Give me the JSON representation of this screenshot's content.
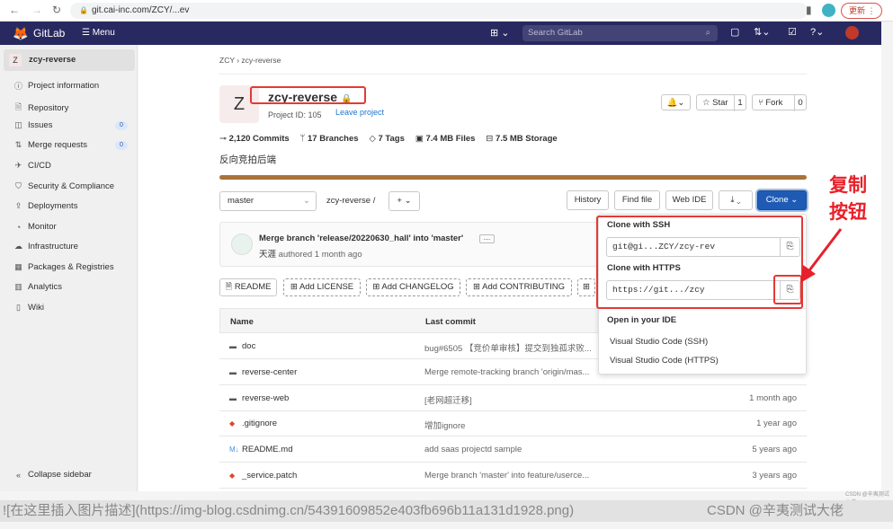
{
  "browser": {
    "url": "git.cai-inc.com/ZCY/...ev",
    "update_label": "更新"
  },
  "nav": {
    "brand": "GitLab",
    "menu": "Menu",
    "search_placeholder": "Search GitLab"
  },
  "sidebar": {
    "project_initial": "Z",
    "project_name": "zcy-reverse",
    "items": [
      {
        "label": "Project information",
        "icon": "info-icon"
      },
      {
        "label": "Repository",
        "icon": "doc-icon"
      },
      {
        "label": "Issues",
        "icon": "issues-icon",
        "badge": "0"
      },
      {
        "label": "Merge requests",
        "icon": "merge-icon",
        "badge": "0"
      },
      {
        "label": "CI/CD",
        "icon": "rocket-icon"
      },
      {
        "label": "Security & Compliance",
        "icon": "shield-icon"
      },
      {
        "label": "Deployments",
        "icon": "deploy-icon"
      },
      {
        "label": "Monitor",
        "icon": "monitor-icon"
      },
      {
        "label": "Infrastructure",
        "icon": "cloud-icon"
      },
      {
        "label": "Packages & Registries",
        "icon": "package-icon"
      },
      {
        "label": "Analytics",
        "icon": "chart-icon"
      },
      {
        "label": "Wiki",
        "icon": "book-icon"
      }
    ],
    "collapse": "Collapse sidebar"
  },
  "breadcrumb": [
    "ZCY",
    "zcy-reverse"
  ],
  "project": {
    "initial": "Z",
    "name": "zcy-reverse",
    "id_text": "Project ID: 105",
    "leave": "Leave project",
    "description": "反向竞拍后端",
    "stats": [
      "2,120 Commits",
      "17 Branches",
      "7 Tags",
      "7.4 MB Files",
      "7.5 MB Storage"
    ],
    "star": "Star",
    "star_count": "1",
    "fork": "Fork",
    "fork_count": "0"
  },
  "toolbar": {
    "branch": "master",
    "path": "zcy-reverse",
    "sep": "/",
    "plus": "+",
    "history": "History",
    "find_file": "Find file",
    "web_ide": "Web IDE",
    "clone": "Clone"
  },
  "commit": {
    "message": "Merge branch 'release/20220630_hall' into 'master'",
    "author": "天涯",
    "meta": "authored 1 month ago"
  },
  "doc_buttons": [
    "README",
    "Add LICENSE",
    "Add CHANGELOG",
    "Add CONTRIBUTING"
  ],
  "table": {
    "headers": [
      "Name",
      "Last commit"
    ],
    "rows": [
      {
        "name": "doc",
        "type": "folder",
        "commit": "bug#6505 【竞价单审核】提交到独孤求败...",
        "date": ""
      },
      {
        "name": "reverse-center",
        "type": "folder",
        "commit": "Merge remote-tracking branch 'origin/mas...",
        "date": ""
      },
      {
        "name": "reverse-web",
        "type": "folder",
        "commit": "[老网超迁移]",
        "date": "1 month ago"
      },
      {
        "name": ".gitignore",
        "type": "git",
        "commit": "增加ignore",
        "date": "1 year ago"
      },
      {
        "name": "README.md",
        "type": "markdown",
        "commit": "add saas projectd sample",
        "date": "5 years ago"
      },
      {
        "name": "_service.patch",
        "type": "git",
        "commit": "Merge branch 'master' into feature/userce...",
        "date": "3 years ago"
      }
    ]
  },
  "clone": {
    "ssh_label": "Clone with SSH",
    "ssh_value": "git@gi...ZCY/zcy-rev",
    "https_label": "Clone with HTTPS",
    "https_value": "https://git.../zcy",
    "ide_label": "Open in your IDE",
    "ide_options": [
      "Visual Studio Code (SSH)",
      "Visual Studio Code (HTTPS)"
    ]
  },
  "annotation": {
    "text1": "复制",
    "text2": "按钮",
    "color": "#e8202a"
  },
  "footer": {
    "markdown": "![在这里插入图片描述](https://img-blog.csdnimg.cn/54391609852e403fb696b11a131d1928.png)",
    "watermark": "CSDN @辛夷测试大佬",
    "small_watermark": "CSDN @辛夷测试大佬"
  },
  "colors": {
    "nav": "#292961",
    "clone_button": "#1f5bb5",
    "progress": "#a8733a"
  }
}
